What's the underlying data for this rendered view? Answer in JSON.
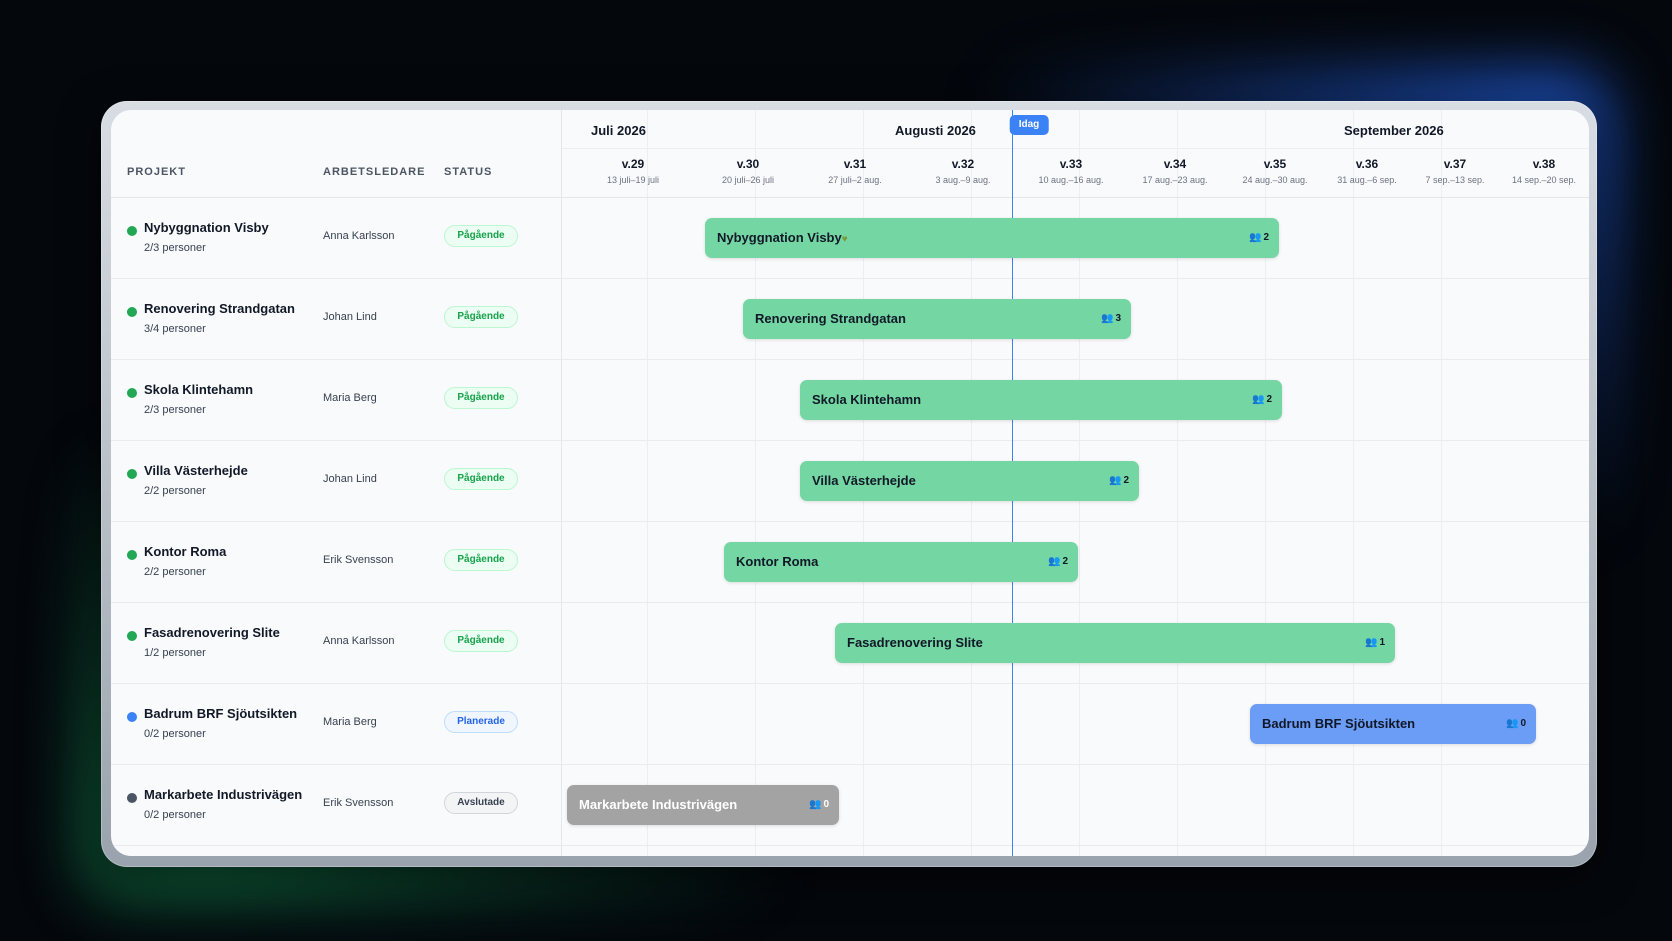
{
  "header": {
    "col_project": "PROJEKT",
    "col_lead": "ARBETSLEDARE",
    "col_status": "STATUS",
    "today_label": "Idag"
  },
  "months": [
    {
      "label": "Juli 2026"
    },
    {
      "label": "Augusti 2026"
    },
    {
      "label": "September 2026"
    }
  ],
  "weeks": [
    {
      "week": "v.29",
      "range": "13 juli–19 juli"
    },
    {
      "week": "v.30",
      "range": "20 juli–26 juli"
    },
    {
      "week": "v.31",
      "range": "27 juli–2 aug."
    },
    {
      "week": "v.32",
      "range": "3 aug.–9 aug."
    },
    {
      "week": "v.33",
      "range": "10 aug.–16 aug."
    },
    {
      "week": "v.34",
      "range": "17 aug.–23 aug."
    },
    {
      "week": "v.35",
      "range": "24 aug.–30 aug."
    },
    {
      "week": "v.36",
      "range": "31 aug.–6 sep."
    },
    {
      "week": "v.37",
      "range": "7 sep.–13 sep."
    },
    {
      "week": "v.38",
      "range": "14 sep.–20 sep."
    }
  ],
  "projects": [
    {
      "name": "Nybyggnation Visby",
      "staffing": "2/3 personer",
      "lead": "Anna Karlsson",
      "status": "Pågående",
      "bar_label": "Nybyggnation Visby",
      "bar_icon": "leaf-icon",
      "people": "2"
    },
    {
      "name": "Renovering Strandgatan",
      "staffing": "3/4 personer",
      "lead": "Johan Lind",
      "status": "Pågående",
      "bar_label": "Renovering Strandgatan",
      "people": "3"
    },
    {
      "name": "Skola Klintehamn",
      "staffing": "2/3 personer",
      "lead": "Maria Berg",
      "status": "Pågående",
      "bar_label": "Skola Klintehamn",
      "people": "2"
    },
    {
      "name": "Villa Västerhejde",
      "staffing": "2/2 personer",
      "lead": "Johan Lind",
      "status": "Pågående",
      "bar_label": "Villa Västerhejde",
      "people": "2"
    },
    {
      "name": "Kontor Roma",
      "staffing": "2/2 personer",
      "lead": "Erik Svensson",
      "status": "Pågående",
      "bar_label": "Kontor Roma",
      "people": "2"
    },
    {
      "name": "Fasadrenovering Slite",
      "staffing": "1/2 personer",
      "lead": "Anna Karlsson",
      "status": "Pågående",
      "bar_label": "Fasadrenovering Slite",
      "people": "1"
    },
    {
      "name": "Badrum BRF Sjöutsikten",
      "staffing": "0/2 personer",
      "lead": "Maria Berg",
      "status": "Planerade",
      "bar_label": "Badrum BRF Sjöutsikten",
      "people": "0"
    },
    {
      "name": "Markarbete Industrivägen",
      "staffing": "0/2 personer",
      "lead": "Erik Svensson",
      "status": "Avslutade",
      "bar_label": "Markarbete Industrivägen",
      "people": "0"
    }
  ],
  "colors": {
    "in_progress": "#74d6a3",
    "planned": "#6b9cf6",
    "finished": "#a3a3a3",
    "today": "#3b82f6"
  }
}
